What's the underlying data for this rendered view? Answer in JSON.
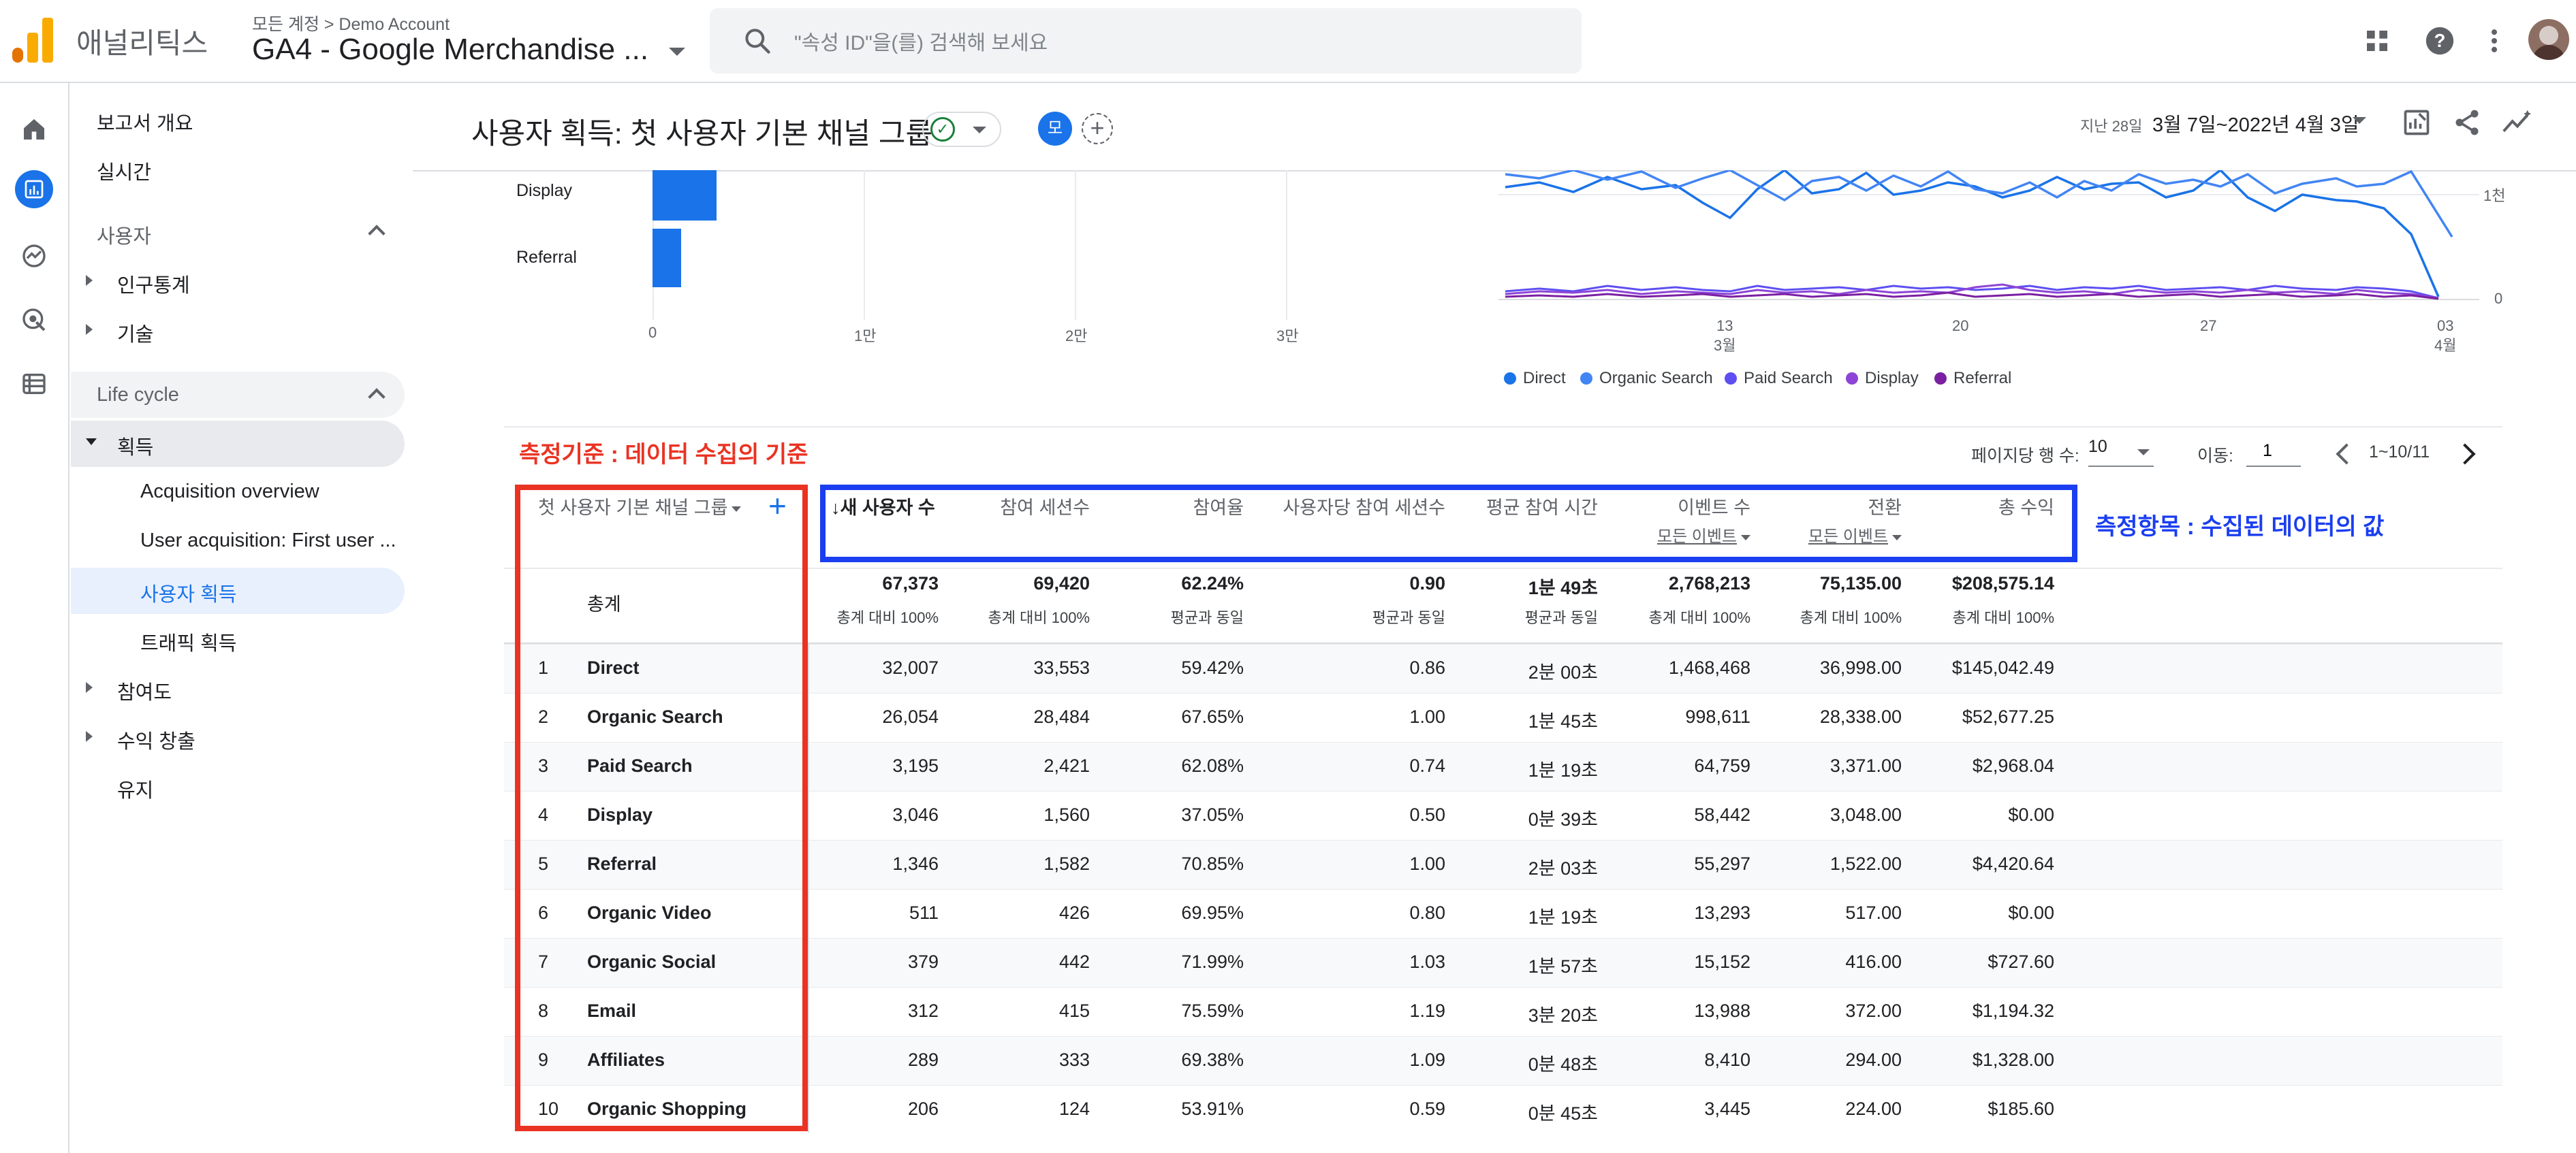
{
  "header": {
    "brand": "애널리틱스",
    "breadcrumb": "모든 계정 > Demo Account",
    "property": "GA4 - Google Merchandise ...",
    "search_placeholder": "\"속성 ID\"을(를) 검색해 보세요",
    "icons": [
      "apps-icon",
      "help-icon",
      "more-vert-icon",
      "avatar"
    ]
  },
  "nav": {
    "items": [
      {
        "label": "보고서 개요"
      },
      {
        "label": "실시간"
      },
      {
        "label": "사용자"
      },
      {
        "label": "인구통계"
      },
      {
        "label": "기술"
      },
      {
        "label": "Life cycle"
      },
      {
        "label": "획득"
      },
      {
        "label": "Acquisition overview"
      },
      {
        "label": "User acquisition: First user ..."
      },
      {
        "label": "사용자 획득"
      },
      {
        "label": "트래픽 획득"
      },
      {
        "label": "참여도"
      },
      {
        "label": "수익 창출"
      },
      {
        "label": "유지"
      }
    ]
  },
  "page": {
    "title": "사용자 획득: 첫 사용자 기본 채널 그룹",
    "compare_chip": "모",
    "date_prefix": "지난 28일",
    "date_range": "3월 7일~2022년 4월 3일"
  },
  "charts": {
    "bar": {
      "categories": [
        "Display",
        "Referral"
      ],
      "values": [
        3046,
        1346
      ],
      "xticks": [
        "0",
        "1만",
        "2만",
        "3만"
      ],
      "xlim": [
        0,
        30000
      ]
    },
    "line": {
      "y_ticks": [
        "1천",
        "0"
      ],
      "x_ticks": [
        {
          "day": "13",
          "month": "3월"
        },
        {
          "day": "20",
          "month": ""
        },
        {
          "day": "27",
          "month": ""
        },
        {
          "day": "03",
          "month": "4월"
        }
      ],
      "legend": [
        {
          "name": "Direct",
          "color": "#1a73e8"
        },
        {
          "name": "Organic Search",
          "color": "#4285f4"
        },
        {
          "name": "Paid Search",
          "color": "#5e4ff2"
        },
        {
          "name": "Display",
          "color": "#8e44d6"
        },
        {
          "name": "Referral",
          "color": "#7b1fa2"
        }
      ]
    }
  },
  "controls": {
    "rows_per_page_label": "페이지당 행 수:",
    "rows_per_page": "10",
    "goto_label": "이동:",
    "goto_value": "1",
    "page_range": "1~10/11"
  },
  "annotations": {
    "dimension": "측정기준 : 데이터 수집의 기준",
    "metrics": "측정항목 : 수집된 데이터의 값"
  },
  "table": {
    "dimension_header": "첫 사용자 기본 채널 그룹",
    "columns": [
      "↓새 사용자 수",
      "참여 세션수",
      "참여율",
      "사용자당 참여 세션수",
      "평균 참여 시간",
      "이벤트 수",
      "전환",
      "총 수익"
    ],
    "event_filter": "모든 이벤트",
    "conversion_filter": "모든 이벤트",
    "total_label": "총계",
    "totals": [
      "67,373",
      "69,420",
      "62.24%",
      "0.90",
      "1분 49초",
      "2,768,213",
      "75,135.00",
      "$208,575.14"
    ],
    "totals_sub": [
      "총계 대비 100%",
      "총계 대비 100%",
      "평균과 동일",
      "평균과 동일",
      "평균과 동일",
      "총계 대비 100%",
      "총계 대비 100%",
      "총계 대비 100%"
    ],
    "rows": [
      {
        "rank": "1",
        "name": "Direct",
        "v": [
          "32,007",
          "33,553",
          "59.42%",
          "0.86",
          "2분 00초",
          "1,468,468",
          "36,998.00",
          "$145,042.49"
        ]
      },
      {
        "rank": "2",
        "name": "Organic Search",
        "v": [
          "26,054",
          "28,484",
          "67.65%",
          "1.00",
          "1분 45초",
          "998,611",
          "28,338.00",
          "$52,677.25"
        ]
      },
      {
        "rank": "3",
        "name": "Paid Search",
        "v": [
          "3,195",
          "2,421",
          "62.08%",
          "0.74",
          "1분 19초",
          "64,759",
          "3,371.00",
          "$2,968.04"
        ]
      },
      {
        "rank": "4",
        "name": "Display",
        "v": [
          "3,046",
          "1,560",
          "37.05%",
          "0.50",
          "0분 39초",
          "58,442",
          "3,048.00",
          "$0.00"
        ]
      },
      {
        "rank": "5",
        "name": "Referral",
        "v": [
          "1,346",
          "1,582",
          "70.85%",
          "1.00",
          "2분 03초",
          "55,297",
          "1,522.00",
          "$4,420.64"
        ]
      },
      {
        "rank": "6",
        "name": "Organic Video",
        "v": [
          "511",
          "426",
          "69.95%",
          "0.80",
          "1분 19초",
          "13,293",
          "517.00",
          "$0.00"
        ]
      },
      {
        "rank": "7",
        "name": "Organic Social",
        "v": [
          "379",
          "442",
          "71.99%",
          "1.03",
          "1분 57초",
          "15,152",
          "416.00",
          "$727.60"
        ]
      },
      {
        "rank": "8",
        "name": "Email",
        "v": [
          "312",
          "415",
          "75.59%",
          "1.19",
          "3분 20초",
          "13,988",
          "372.00",
          "$1,194.32"
        ]
      },
      {
        "rank": "9",
        "name": "Affiliates",
        "v": [
          "289",
          "333",
          "69.38%",
          "1.09",
          "0분 48초",
          "8,410",
          "294.00",
          "$1,328.00"
        ]
      },
      {
        "rank": "10",
        "name": "Organic Shopping",
        "v": [
          "206",
          "124",
          "53.91%",
          "0.59",
          "0분 45초",
          "3,445",
          "224.00",
          "$185.60"
        ]
      }
    ]
  },
  "colors": {
    "accent": "#1a73e8",
    "annotation_red": "#ea3323",
    "annotation_blue": "#1a3ef0",
    "logo": "#f9ab00"
  }
}
